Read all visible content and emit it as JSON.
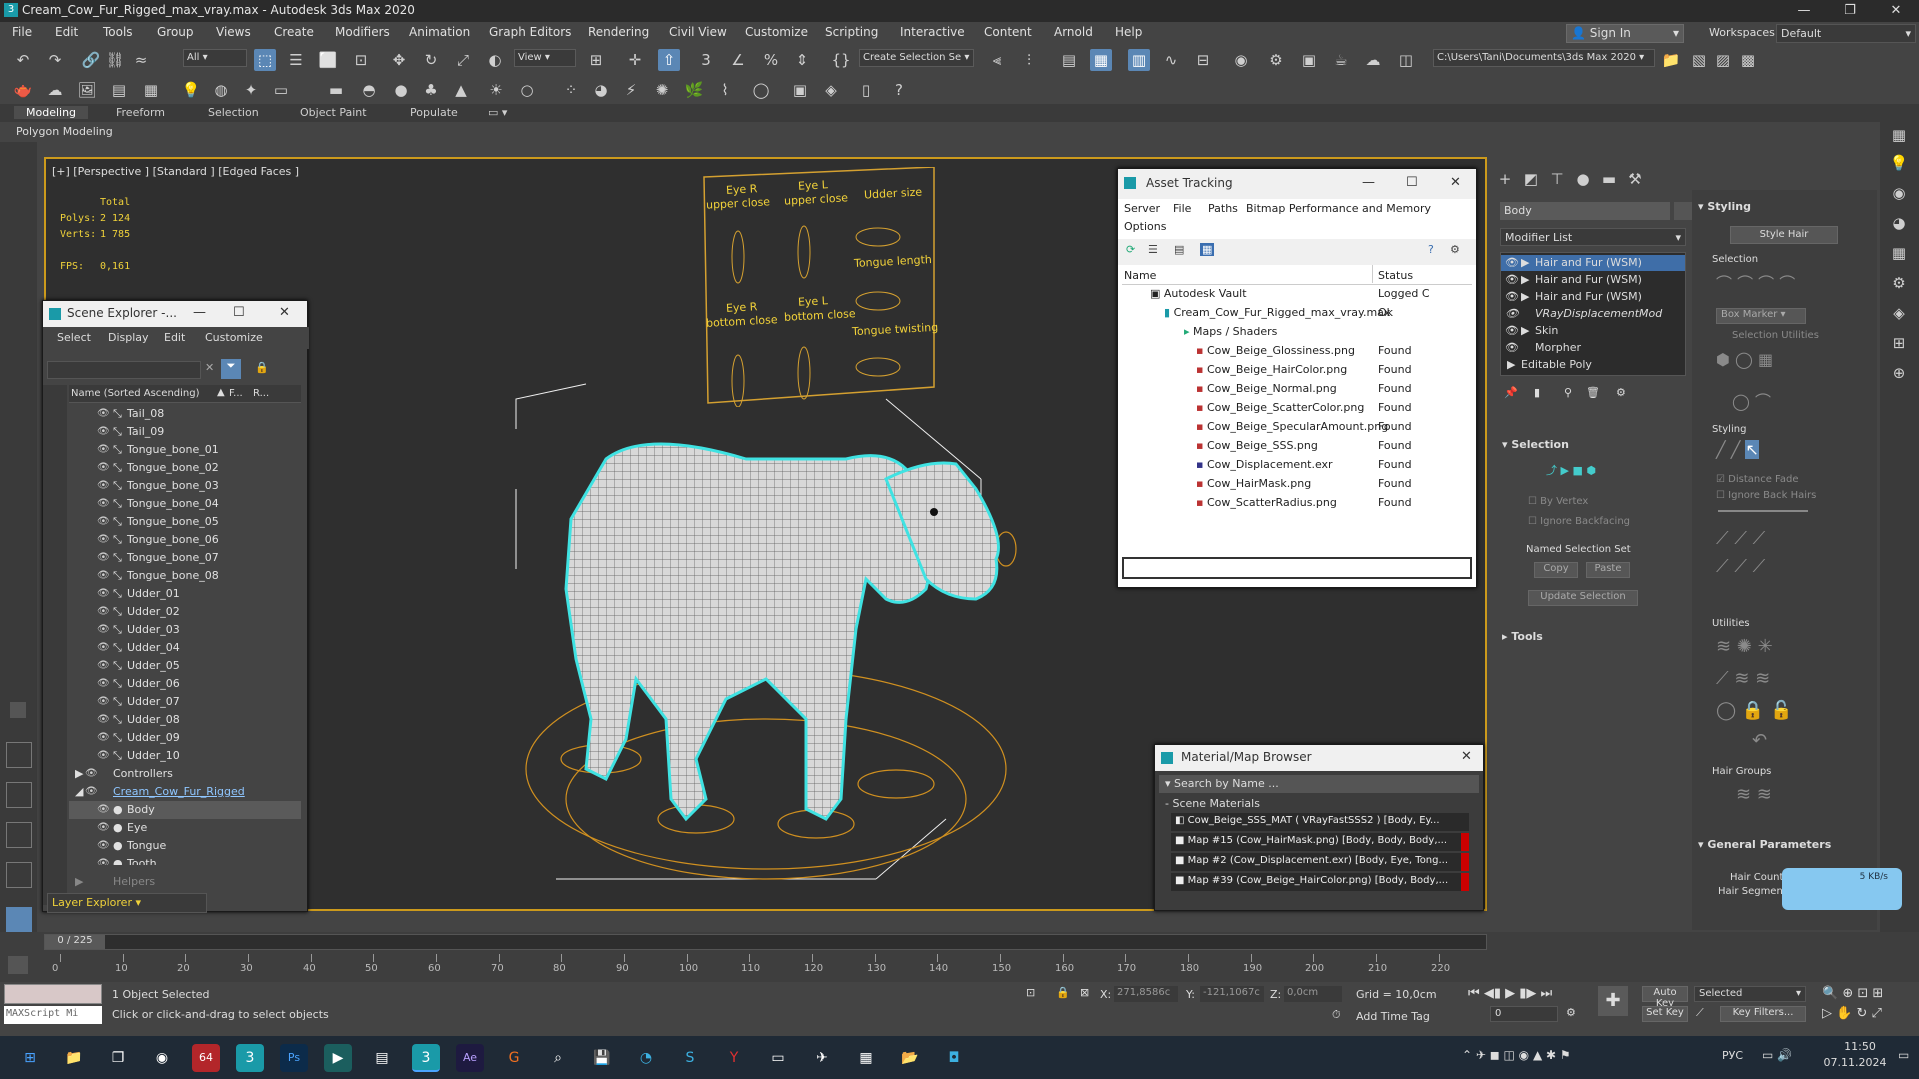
{
  "app": {
    "title": "Cream_Cow_Fur_Rigged_max_vray.max - Autodesk 3ds Max 2020",
    "icon": "3"
  },
  "menus": [
    "File",
    "Edit",
    "Tools",
    "Group",
    "Views",
    "Create",
    "Modifiers",
    "Animation",
    "Graph Editors",
    "Rendering",
    "Civil View",
    "Customize",
    "Scripting",
    "Interactive",
    "Content",
    "Arnold",
    "Help"
  ],
  "signin": "Sign In",
  "workspaces": {
    "label": "Workspaces:",
    "value": "Default"
  },
  "toolbar": {
    "filter": "All",
    "refcoord": "View",
    "selset": "Create Selection Se",
    "path": "C:\\Users\\Tani\\Documents\\3ds Max 2020"
  },
  "ribbon": {
    "tabs": [
      "Modeling",
      "Freeform",
      "Selection",
      "Object Paint",
      "Populate"
    ],
    "sub": "Polygon Modeling"
  },
  "viewport": {
    "label": "[+] [Perspective ] [Standard ] [Edged Faces ]",
    "stats": {
      "total": "Total",
      "polys_label": "Polys:",
      "polys": "2 124",
      "verts_label": "Verts:",
      "verts": "1 785",
      "fps_label": "FPS:",
      "fps": "0,161"
    },
    "board": [
      "Eye R",
      "upper close",
      "Eye L",
      "upper close",
      "Udder size",
      "Tongue length",
      "Eye R",
      "bottom close",
      "Eye L",
      "bottom close",
      "Tongue twisting"
    ]
  },
  "scene_explorer": {
    "title": "Scene Explorer -...",
    "menus": [
      "Select",
      "Display",
      "Edit",
      "Customize"
    ],
    "col_name": "Name (Sorted Ascending)",
    "col_f": "F...",
    "col_r": "R...",
    "rows": [
      "Tail_08",
      "Tail_09",
      "Tongue_bone_01",
      "Tongue_bone_02",
      "Tongue_bone_03",
      "Tongue_bone_04",
      "Tongue_bone_05",
      "Tongue_bone_06",
      "Tongue_bone_07",
      "Tongue_bone_08",
      "Udder_01",
      "Udder_02",
      "Udder_03",
      "Udder_04",
      "Udder_05",
      "Udder_06",
      "Udder_07",
      "Udder_08",
      "Udder_09",
      "Udder_10"
    ],
    "controllers": "Controllers",
    "group": "Cream_Cow_Fur_Rigged",
    "children": [
      "Body",
      "Eye",
      "Tongue",
      "Tooth"
    ],
    "helpers": "Helpers",
    "layer": "Layer Explorer"
  },
  "asset_tracking": {
    "title": "Asset Tracking",
    "menus": [
      "Server",
      "File",
      "Paths",
      "Bitmap Performance and Memory",
      "Options"
    ],
    "col_name": "Name",
    "col_status": "Status",
    "vault": "Autodesk Vault",
    "vault_status": "Logged C",
    "file": "Cream_Cow_Fur_Rigged_max_vray.max",
    "file_status": "Ok",
    "folder": "Maps / Shaders",
    "maps": [
      "Cow_Beige_Glossiness.png",
      "Cow_Beige_HairColor.png",
      "Cow_Beige_Normal.png",
      "Cow_Beige_ScatterColor.png",
      "Cow_Beige_SpecularAmount.png",
      "Cow_Beige_SSS.png",
      "Cow_Displacement.exr",
      "Cow_HairMask.png",
      "Cow_ScatterRadius.png"
    ],
    "found": "Found"
  },
  "mat_browser": {
    "title": "Material/Map Browser",
    "search": "Search by Name ...",
    "section": "Scene Materials",
    "items": [
      "Cow_Beige_SSS_MAT  ( VRayFastSSS2 )  [Body, Ey...",
      "Map #15 (Cow_HairMask.png) [Body, Body, Body,...",
      "Map #2 (Cow_Displacement.exr) [Body, Eye, Tong...",
      "Map #39 (Cow_Beige_HairColor.png) [Body, Body,..."
    ]
  },
  "modify_panel": {
    "name": "Body",
    "modlist": "Modifier List",
    "stack": [
      "Hair and Fur (WSM)",
      "Hair and Fur (WSM)",
      "Hair and Fur (WSM)",
      "VRayDisplacementMod",
      "Skin",
      "Morpher",
      "Editable Poly"
    ],
    "selection": "Selection",
    "by_vertex": "By Vertex",
    "ignore_bf": "Ignore Backfacing",
    "named_sel": "Named Selection Set",
    "copy": "Copy",
    "paste": "Paste",
    "update": "Update Selection",
    "tools": "Tools"
  },
  "hair_panel": {
    "styling": "Styling",
    "style_hair": "Style Hair",
    "selection": "Selection",
    "box_marker": "Box Marker",
    "sel_utilities": "Selection Utilities",
    "styling2": "Styling",
    "distance_fade": "Distance Fade",
    "ignore_back": "Ignore Back Hairs",
    "utilities": "Utilities",
    "hair_groups": "Hair Groups",
    "general": "General Parameters",
    "hair_count": "Hair Count",
    "hair_segments": "Hair Segments",
    "net": "5 KB/s"
  },
  "timeline": {
    "frame": "0 / 225",
    "ticks": [
      "0",
      "10",
      "20",
      "30",
      "40",
      "50",
      "60",
      "70",
      "80",
      "90",
      "100",
      "110",
      "120",
      "130",
      "140",
      "150",
      "160",
      "170",
      "180",
      "190",
      "200",
      "210",
      "220"
    ]
  },
  "status": {
    "maxscript": "MAXScript Mi",
    "selected": "1 Object Selected",
    "hint": "Click or click-and-drag to select objects",
    "x_label": "X:",
    "x": "271,8586c",
    "y_label": "Y:",
    "y": "-121,1067c",
    "z_label": "Z:",
    "z": "0,0cm",
    "grid": "Grid = 10,0cm",
    "add_time_tag": "Add Time Tag",
    "autokey": "Auto Key",
    "setkey": "Set Key",
    "selected_drop": "Selected",
    "key_filters": "Key Filters...",
    "frame": "0"
  },
  "taskbar": {
    "lang": "РУС",
    "time": "11:50",
    "date": "07.11.2024"
  }
}
